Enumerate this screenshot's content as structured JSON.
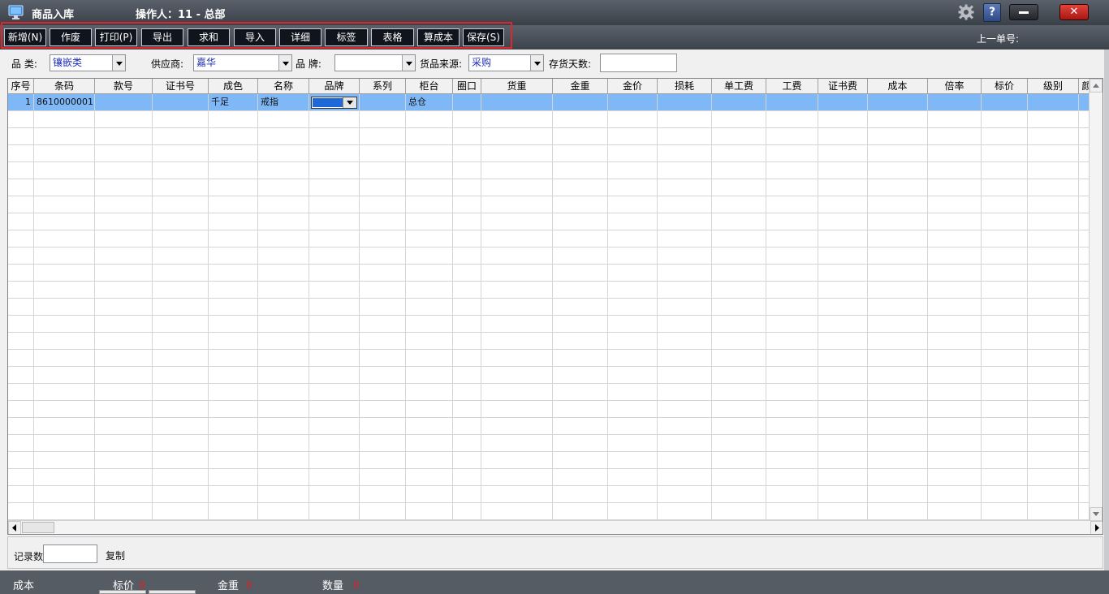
{
  "window": {
    "title": "商品入库",
    "operator": "操作人：11 - 总部",
    "help_label": "?",
    "close_label": "✕",
    "app_icon": "monitor-icon",
    "settings_icon": "gear-icon"
  },
  "toolbar": {
    "buttons": [
      "新增(N)",
      "作废",
      "打印(P)",
      "导出",
      "求和",
      "导入",
      "详细",
      "标签",
      "表格",
      "算成本",
      "保存(S)"
    ],
    "prev_order_label": "上一单号:",
    "highlight_color": "#e0262b"
  },
  "filters": {
    "category_label": "品  类:",
    "category_value": "镶嵌类",
    "supplier_label": "供应商:",
    "supplier_value": "嘉华",
    "brand_label": "品  牌:",
    "brand_value": "",
    "source_label": "货品来源:",
    "source_value": "采购",
    "days_label": "存货天数:",
    "days_value": ""
  },
  "table": {
    "columns": [
      "序号",
      "条码",
      "款号",
      "证书号",
      "成色",
      "名称",
      "品牌",
      "系列",
      "柜台",
      "圈口",
      "货重",
      "金重",
      "金价",
      "损耗",
      "单工费",
      "工费",
      "证书费",
      "成本",
      "倍率",
      "标价",
      "级别",
      "颜"
    ],
    "rows": [
      [
        "1",
        "8610000001",
        "",
        "",
        "千足",
        "戒指",
        "",
        "",
        "总仓",
        "",
        "",
        "",
        "",
        "",
        "",
        "",
        "",
        "",
        "",
        "",
        "",
        ""
      ]
    ],
    "selected_row_color": "#7eb8f6"
  },
  "footer": {
    "records_label": "记录数",
    "records_value": "",
    "copy_label": "复制"
  },
  "status": {
    "cost_label": "成本",
    "tag_price_label": "标价",
    "tag_price_value": "0",
    "gold_weight_label": "金重",
    "gold_weight_value": "0",
    "quantity_label": "数量",
    "quantity_value": "0"
  }
}
